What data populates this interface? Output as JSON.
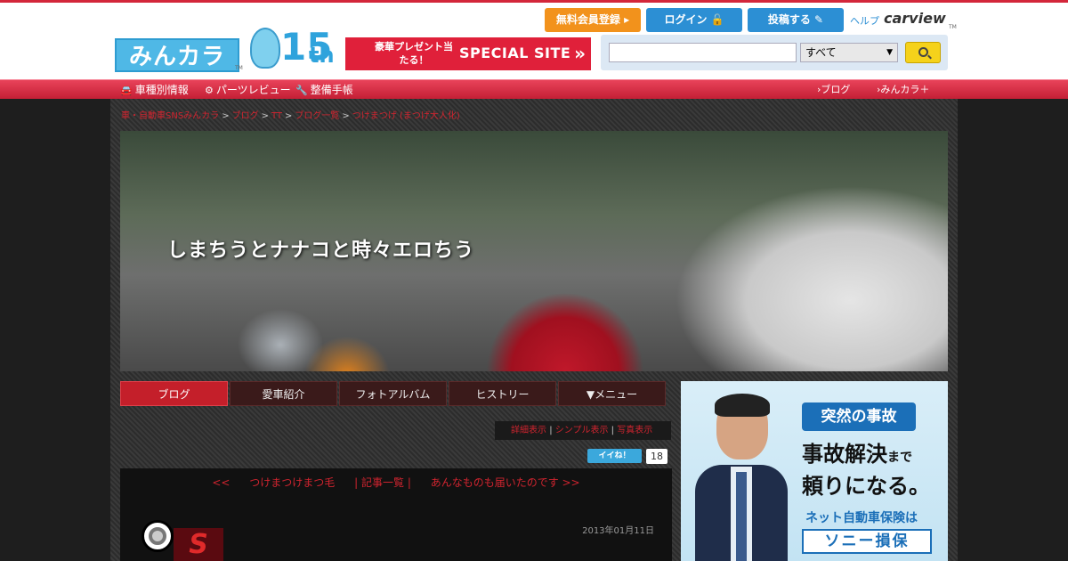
{
  "header": {
    "logo_text": "みんカラ",
    "logo_tm": "TM",
    "anniversary": {
      "number": "15",
      "suffix": "th"
    },
    "special_banner": {
      "small": "豪華プレゼント当たる！",
      "big": "SPECIAL SITE",
      "arrow": "»"
    },
    "buttons": {
      "register": "無料会員登録 ▸",
      "login": "ログイン 🔓",
      "post": "投稿する ✎"
    },
    "help": "ヘルプ",
    "carview": "carview",
    "carview_tm": "TM",
    "search": {
      "value": "",
      "placeholder": "",
      "category": "すべて"
    }
  },
  "nav": {
    "car_info": "車種別情報",
    "parts_review": "パーツレビュー",
    "maintenance": "整備手帳",
    "blog": "ブログ",
    "minkara_plus": "みんカラ＋"
  },
  "breadcrumb": {
    "items": [
      "車・自動車SNSみんカラ",
      "ブログ",
      "TT",
      "ブログ一覧",
      "つけまつげ (まつげ大人化)"
    ],
    "separator": ">"
  },
  "banner": {
    "title": "しまちうとナナコと時々エロちう"
  },
  "tabs": [
    "ブログ",
    "愛車紹介",
    "フォトアルバム",
    "ヒストリー",
    "▼メニュー"
  ],
  "view_options": {
    "detail": "詳細表示",
    "simple": "シンプル表示",
    "photo": "写真表示",
    "divider": "|"
  },
  "like": {
    "label": "イイね！",
    "count": "18"
  },
  "article": {
    "pager": {
      "prev_arrow": "<<",
      "prev_title": "つけまつけまつ毛",
      "list": "| 記事一覧 |",
      "next_title": "あんなものも届いたのです >>"
    },
    "date": "2013年01月11日"
  },
  "ad": {
    "badge": "突然の事故",
    "line1": "事故解決",
    "line1_small": "まで",
    "line2": "頼りになる。",
    "sub": "ネット自動車保険は",
    "brand": "ソニー損保"
  },
  "colors": {
    "accent_red": "#d3263a",
    "nav_blue": "#2c8fd4",
    "register_orange": "#f2921c",
    "search_yellow": "#f5d21b"
  }
}
